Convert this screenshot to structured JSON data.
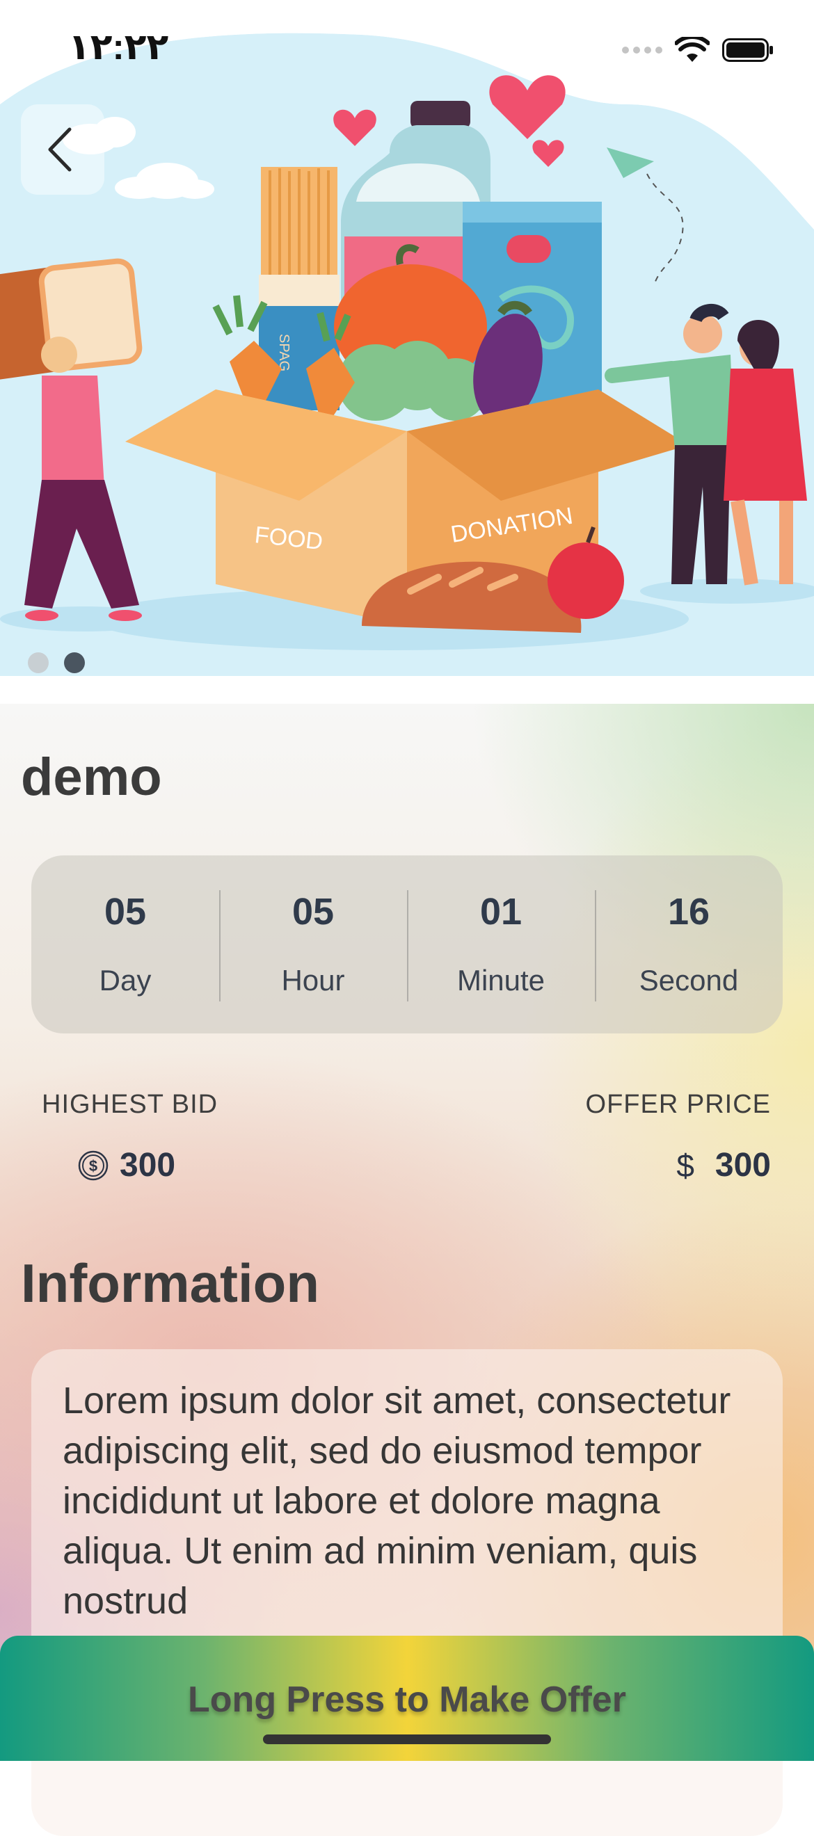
{
  "status_bar": {
    "time": "۱۲:۲۲"
  },
  "hero": {
    "box_labels": [
      "FOOD",
      "DONATION"
    ],
    "pasta_label": "SPAG",
    "carousel": {
      "count": 2,
      "active_index": 1
    }
  },
  "product": {
    "title": "demo"
  },
  "countdown": [
    {
      "value": "05",
      "label": "Day"
    },
    {
      "value": "05",
      "label": "Hour"
    },
    {
      "value": "01",
      "label": "Minute"
    },
    {
      "value": "16",
      "label": "Second"
    }
  ],
  "bids": {
    "highest_bid_label": "HIGHEST BID",
    "highest_bid_value": "300",
    "offer_price_label": "OFFER PRICE",
    "offer_price_currency": "$",
    "offer_price_value": "300"
  },
  "information": {
    "heading": "Information",
    "body": "Lorem ipsum dolor sit amet, consectetur adipiscing elit, sed do eiusmod tempor incididunt ut labore et dolore magna aliqua. Ut enim ad minim veniam, quis nostrud"
  },
  "offer_button": {
    "label": "Long Press to Make Offer"
  },
  "colors": {
    "hero_sky": "#d5f0f9",
    "button_teal": "#139a80",
    "button_yellow": "#f3d43a",
    "heart": "#f0506e",
    "box": "#f6be7c"
  }
}
